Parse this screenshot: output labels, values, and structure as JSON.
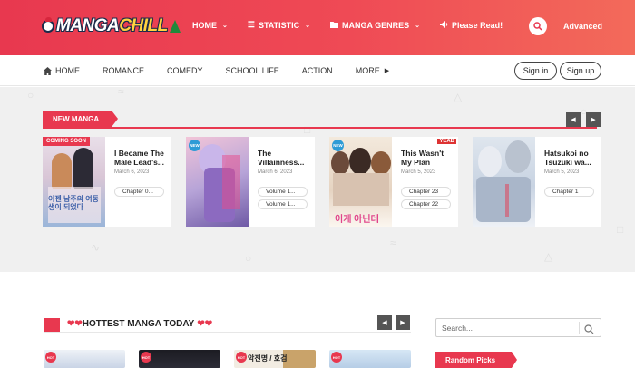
{
  "brand": {
    "logo_text_a": "MANGA",
    "logo_text_b": "CHILL",
    "accent": "#e8384f"
  },
  "topnav": {
    "items": [
      {
        "label": "HOME",
        "icon": "none",
        "chevron": true
      },
      {
        "label": "STATISTIC",
        "icon": "bars-icon",
        "chevron": true
      },
      {
        "label": "MANGA GENRES",
        "icon": "folder-icon",
        "chevron": true
      },
      {
        "label": "Please Read!",
        "icon": "megaphone-icon",
        "chevron": false
      }
    ],
    "advanced_label": "Advanced"
  },
  "subnav": {
    "items": [
      {
        "label": "HOME"
      },
      {
        "label": "ROMANCE"
      },
      {
        "label": "COMEDY"
      },
      {
        "label": "SCHOOL LIFE"
      },
      {
        "label": "ACTION"
      },
      {
        "label": "MORE"
      }
    ],
    "sign_in": "Sign in",
    "sign_up": "Sign up"
  },
  "new_manga": {
    "heading": "NEW MANGA",
    "cards": [
      {
        "title_line1": "I Became The",
        "title_line2": "Male Lead's...",
        "date": "March 6, 2023",
        "badge": "COMING SOON",
        "chapters": [
          "Chapter 0..."
        ],
        "cover_text": "이젠 남주의 여동생이 되었다"
      },
      {
        "title_line1": "The",
        "title_line2": "Villainness...",
        "date": "March 6, 2023",
        "badge": "NEW",
        "chapters": [
          "Volume 1...",
          "Volume 1..."
        ],
        "cover_text": ""
      },
      {
        "title_line1": "This Wasn't",
        "title_line2": "My Plan",
        "date": "March 5, 2023",
        "badge": "NEW",
        "chapters": [
          "Chapter 23",
          "Chapter 22"
        ],
        "cover_text": "이게 아닌데",
        "corner_tag": "YEAB"
      },
      {
        "title_line1": "Hatsukoi no",
        "title_line2": "Tsuzuki wa...",
        "date": "March 5, 2023",
        "badge": "",
        "chapters": [
          "Chapter 1"
        ],
        "cover_text": ""
      }
    ]
  },
  "hottest": {
    "heading": "HOTTEST MANGA TODAY",
    "badges": [
      "HOT",
      "HOT",
      "HOT",
      "HOT"
    ],
    "thumb_text": [
      "",
      "",
      "악전명 / 호검",
      ""
    ]
  },
  "sidebar": {
    "search_placeholder": "Search...",
    "random_heading": "Random Picks"
  }
}
